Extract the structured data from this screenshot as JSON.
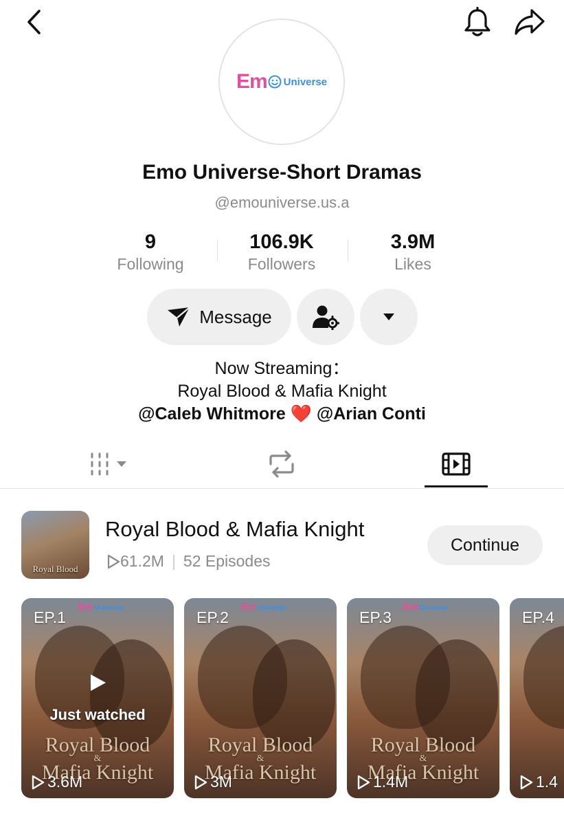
{
  "header": {
    "back_icon": "chevron-left-icon",
    "bell_icon": "bell-icon",
    "share_icon": "share-icon"
  },
  "profile": {
    "avatar_logo": {
      "em": "Em",
      "universe": "Universe"
    },
    "display_name": "Emo Universe-Short Dramas",
    "handle": "@emouniverse.us.a"
  },
  "stats": {
    "following": {
      "value": "9",
      "label": "Following"
    },
    "followers": {
      "value": "106.9K",
      "label": "Followers"
    },
    "likes": {
      "value": "3.9M",
      "label": "Likes"
    }
  },
  "actions": {
    "message_label": "Message",
    "message_icon": "send-icon",
    "friend_settings_icon": "person-gear-icon",
    "more_icon": "caret-down-icon"
  },
  "bio": {
    "line1": "Now Streaming：",
    "line2": "Royal Blood & Mafia Knight",
    "mention1": "@Caleb Whitmore",
    "heart": "❤️",
    "mention2": "@Arian Conti"
  },
  "tabs": {
    "videos_icon": "grid-icon",
    "reposts_icon": "repost-icon",
    "series_icon": "film-icon",
    "active": "series"
  },
  "series": {
    "title": "Royal Blood & Mafia Knight",
    "views": "61.2M",
    "separator": "|",
    "episodes": "52 Episodes",
    "continue_label": "Continue",
    "thumb_caption": "Royal Blood"
  },
  "episodes": [
    {
      "label": "EP.1",
      "views": "3.6M",
      "status": "Just watched"
    },
    {
      "label": "EP.2",
      "views": "3M"
    },
    {
      "label": "EP.3",
      "views": "1.4M"
    },
    {
      "label": "EP.4",
      "views": "1.4"
    }
  ],
  "episode_art": {
    "brand_em": "Em",
    "brand_universe": "Universe",
    "line1": "Royal Blood",
    "amp": "&",
    "line2": "Mafia Knight"
  },
  "colors": {
    "brand_pink": "#e0519b",
    "brand_blue": "#3d8fe0",
    "heart": "#e8202f"
  }
}
